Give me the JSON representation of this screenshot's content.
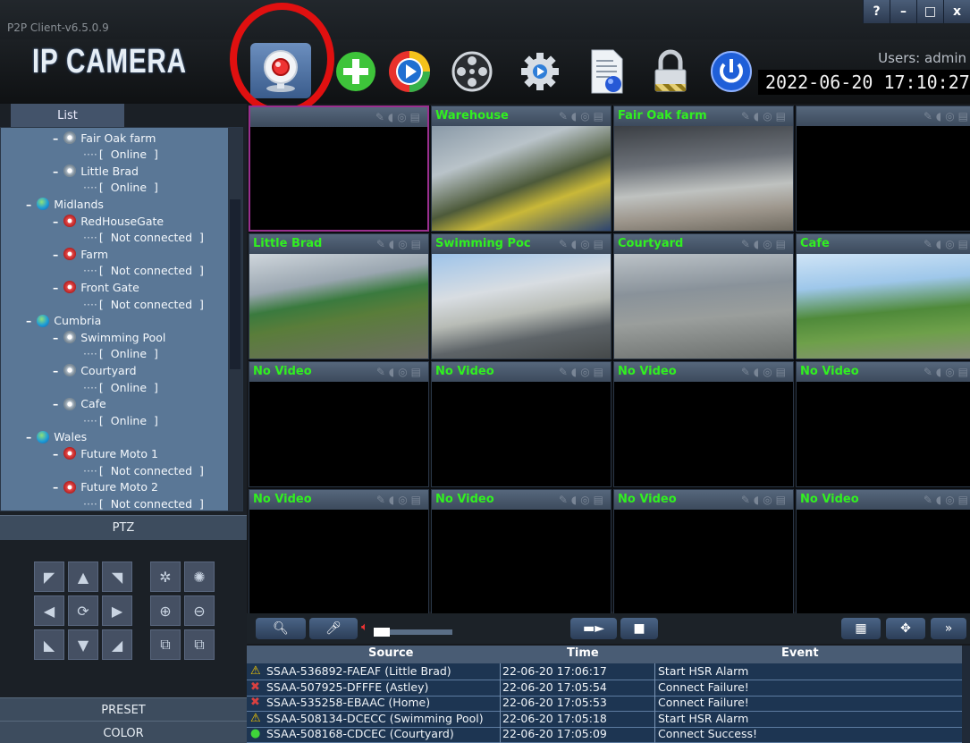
{
  "window": {
    "title": "P2P Client-v6.5.0.9",
    "buttons": [
      "?",
      "–",
      "□",
      "x"
    ]
  },
  "header": {
    "brand": "IP CAMERA",
    "users": "Users: admin",
    "datetime": "2022-06-20  17:10:27",
    "toolbar": [
      {
        "name": "live-view",
        "icon": "webcam-icon",
        "active": true
      },
      {
        "name": "add-device",
        "icon": "plus-icon"
      },
      {
        "name": "playback",
        "icon": "play-icon"
      },
      {
        "name": "ptz-control",
        "icon": "film-reel-icon"
      },
      {
        "name": "settings",
        "icon": "gear-icon"
      },
      {
        "name": "log-report",
        "icon": "document-icon"
      },
      {
        "name": "lock",
        "icon": "lock-icon"
      },
      {
        "name": "power",
        "icon": "power-icon"
      }
    ]
  },
  "list": {
    "tab_label": "List",
    "items": [
      {
        "type": "device",
        "label": "Fair Oak farm",
        "status": "[  Online  ]",
        "online": true
      },
      {
        "type": "device",
        "label": "Little Brad",
        "status": "[  Online  ]",
        "online": true
      },
      {
        "type": "group",
        "label": "Midlands"
      },
      {
        "type": "device",
        "label": "RedHouseGate",
        "status": "[  Not connected  ]",
        "online": false
      },
      {
        "type": "device",
        "label": "Farm",
        "status": "[  Not connected  ]",
        "online": false
      },
      {
        "type": "device",
        "label": "Front Gate",
        "status": "[  Not connected  ]",
        "online": false
      },
      {
        "type": "group",
        "label": "Cumbria"
      },
      {
        "type": "device",
        "label": "Swimming Pool",
        "status": "[  Online  ]",
        "online": true
      },
      {
        "type": "device",
        "label": "Courtyard",
        "status": "[  Online  ]",
        "online": true
      },
      {
        "type": "device",
        "label": "Cafe",
        "status": "[  Online  ]",
        "online": true
      },
      {
        "type": "group",
        "label": "Wales"
      },
      {
        "type": "device",
        "label": "Future Moto 1",
        "status": "[  Not connected  ]",
        "online": false
      },
      {
        "type": "device",
        "label": "Future Moto 2",
        "status": "[  Not connected  ]",
        "online": false
      }
    ]
  },
  "panels": {
    "ptz": "PTZ",
    "preset": "PRESET",
    "color": "COLOR"
  },
  "grid": {
    "cells": [
      {
        "title": ""
      },
      {
        "title": "Warehouse"
      },
      {
        "title": "Fair Oak farm"
      },
      {
        "title": ""
      },
      {
        "title": "Little Brad"
      },
      {
        "title": "Swimming Poc"
      },
      {
        "title": "Courtyard"
      },
      {
        "title": "Cafe"
      },
      {
        "title": "No Video"
      },
      {
        "title": "No Video"
      },
      {
        "title": "No Video"
      },
      {
        "title": "No Video"
      },
      {
        "title": "No Video"
      },
      {
        "title": "No Video"
      },
      {
        "title": "No Video"
      },
      {
        "title": "No Video"
      }
    ]
  },
  "log": {
    "headers": {
      "source": "Source",
      "time": "Time",
      "event": "Event"
    },
    "rows": [
      {
        "icon": "warning-icon",
        "source": "SSAA-536892-FAEAF (Little Brad)",
        "time": "22-06-20 17:06:17",
        "event": "Start HSR Alarm"
      },
      {
        "icon": "disconnect-icon",
        "source": "SSAA-507925-DFFFE (Astley)",
        "time": "22-06-20 17:05:54",
        "event": "Connect Failure!"
      },
      {
        "icon": "disconnect-icon",
        "source": "SSAA-535258-EBAAC (Home)",
        "time": "22-06-20 17:05:53",
        "event": "Connect Failure!"
      },
      {
        "icon": "warning-icon",
        "source": "SSAA-508134-DCECC (Swimming Pool)",
        "time": "22-06-20 17:05:18",
        "event": "Start HSR Alarm"
      },
      {
        "icon": "success-icon",
        "source": "SSAA-508168-CDCEC (Courtyard)",
        "time": "22-06-20 17:05:09",
        "event": "Connect Success!"
      }
    ]
  },
  "colors": {
    "accent": "#31f020",
    "highlight": "#e01010",
    "panel": "#5a7796"
  }
}
